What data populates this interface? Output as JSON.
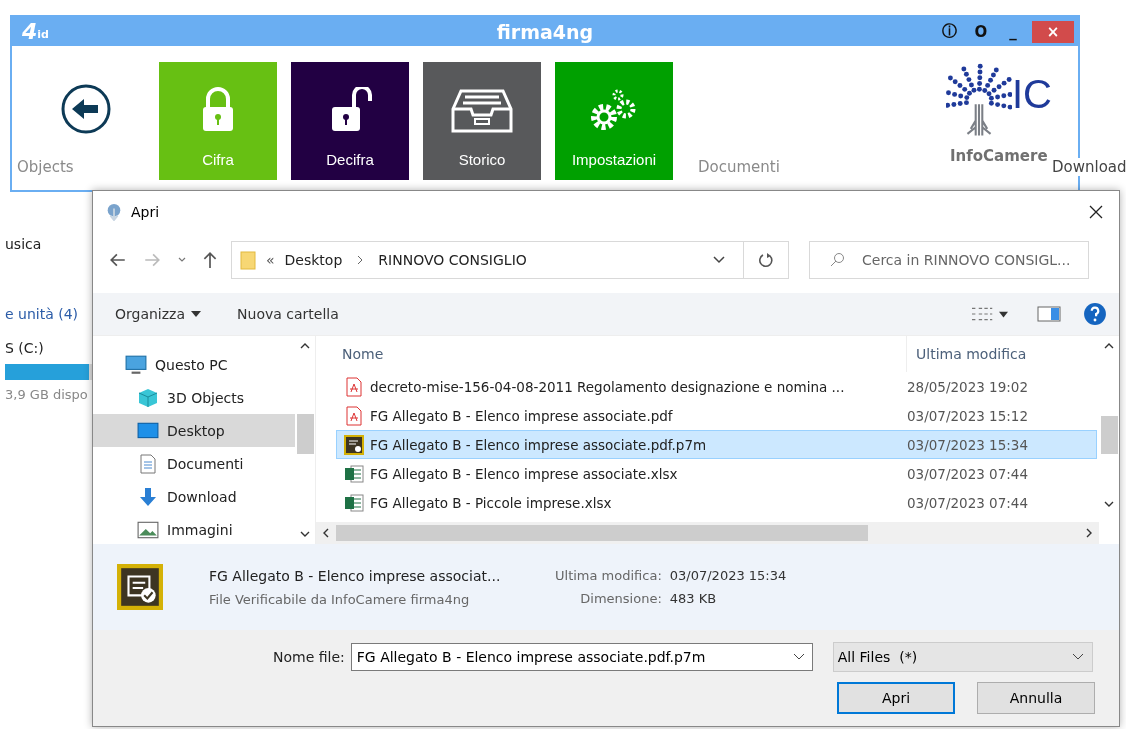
{
  "background": {
    "ribbon_labels": [
      "Objects",
      "Documenti",
      "Download"
    ],
    "side_items": [
      "usica",
      "e unità (4)",
      "S (C:)"
    ],
    "drive": {
      "level": 0.95,
      "free": "3,9 GB dispo"
    }
  },
  "firma_window": {
    "logo": "4",
    "logo_sub": "id",
    "title": "firma4ng",
    "controls": [
      "ⓘ",
      "O",
      "_",
      "×"
    ],
    "tiles": [
      {
        "label": "Cifra",
        "kind": "lock",
        "color": "#67c013"
      },
      {
        "label": "Decifra",
        "kind": "unlock",
        "color": "#220043"
      },
      {
        "label": "Storico",
        "kind": "archive",
        "color": "#58595b"
      },
      {
        "label": "Impostazioni",
        "kind": "gears",
        "color": "#00a000"
      }
    ],
    "brand": {
      "mark": "IC",
      "name": "InfoCamere"
    }
  },
  "dialog": {
    "title": "Apri",
    "breadcrumb": {
      "overflow": "«",
      "items": [
        "Desktop",
        "RINNOVO CONSIGLIO"
      ]
    },
    "search": {
      "placeholder": "Cerca in RINNOVO CONSIGL..."
    },
    "toolbar": {
      "organize": "Organizza",
      "new_folder": "Nuova cartella"
    },
    "nav_items": [
      {
        "label": "Questo PC",
        "kind": "pc",
        "selected": false,
        "children": [
          {
            "label": "3D Objects",
            "kind": "cube",
            "selected": false
          },
          {
            "label": "Desktop",
            "kind": "desktop",
            "selected": true
          },
          {
            "label": "Documenti",
            "kind": "doc",
            "selected": false
          },
          {
            "label": "Download",
            "kind": "download",
            "selected": false
          },
          {
            "label": "Immagini",
            "kind": "image",
            "selected": false
          }
        ]
      }
    ],
    "columns": [
      "Nome",
      "Ultima modifica"
    ],
    "files": [
      {
        "name": "decreto-mise-156-04-08-2011 Regolamento designazione e nomina ...",
        "modified": "28/05/2023 19:02",
        "kind": "pdf",
        "selected": false
      },
      {
        "name": "FG Allegato B - Elenco imprese associate.pdf",
        "modified": "03/07/2023 15:12",
        "kind": "pdf",
        "selected": false
      },
      {
        "name": "FG Allegato B - Elenco imprese associate.pdf.p7m",
        "modified": "03/07/2023 15:34",
        "kind": "p7m",
        "selected": true
      },
      {
        "name": "FG Allegato B - Elenco imprese associate.xlsx",
        "modified": "03/07/2023 07:44",
        "kind": "xlsx",
        "selected": false
      },
      {
        "name": "FG Allegato B - Piccole imprese.xlsx",
        "modified": "03/07/2023 07:44",
        "kind": "xlsx",
        "selected": false
      }
    ],
    "details": {
      "name": "FG Allegato B - Elenco imprese associat...",
      "type": "File Verificabile da InfoCamere firma4ng",
      "fields": [
        {
          "label": "Ultima modifica:",
          "value": "03/07/2023 15:34"
        },
        {
          "label": "Dimensione:",
          "value": "483 KB"
        }
      ]
    },
    "filename": {
      "label": "Nome file:",
      "value": "FG Allegato B - Elenco imprese associate.pdf.p7m"
    },
    "filter": "All Files  (*)",
    "buttons": [
      "Apri",
      "Annulla"
    ]
  }
}
